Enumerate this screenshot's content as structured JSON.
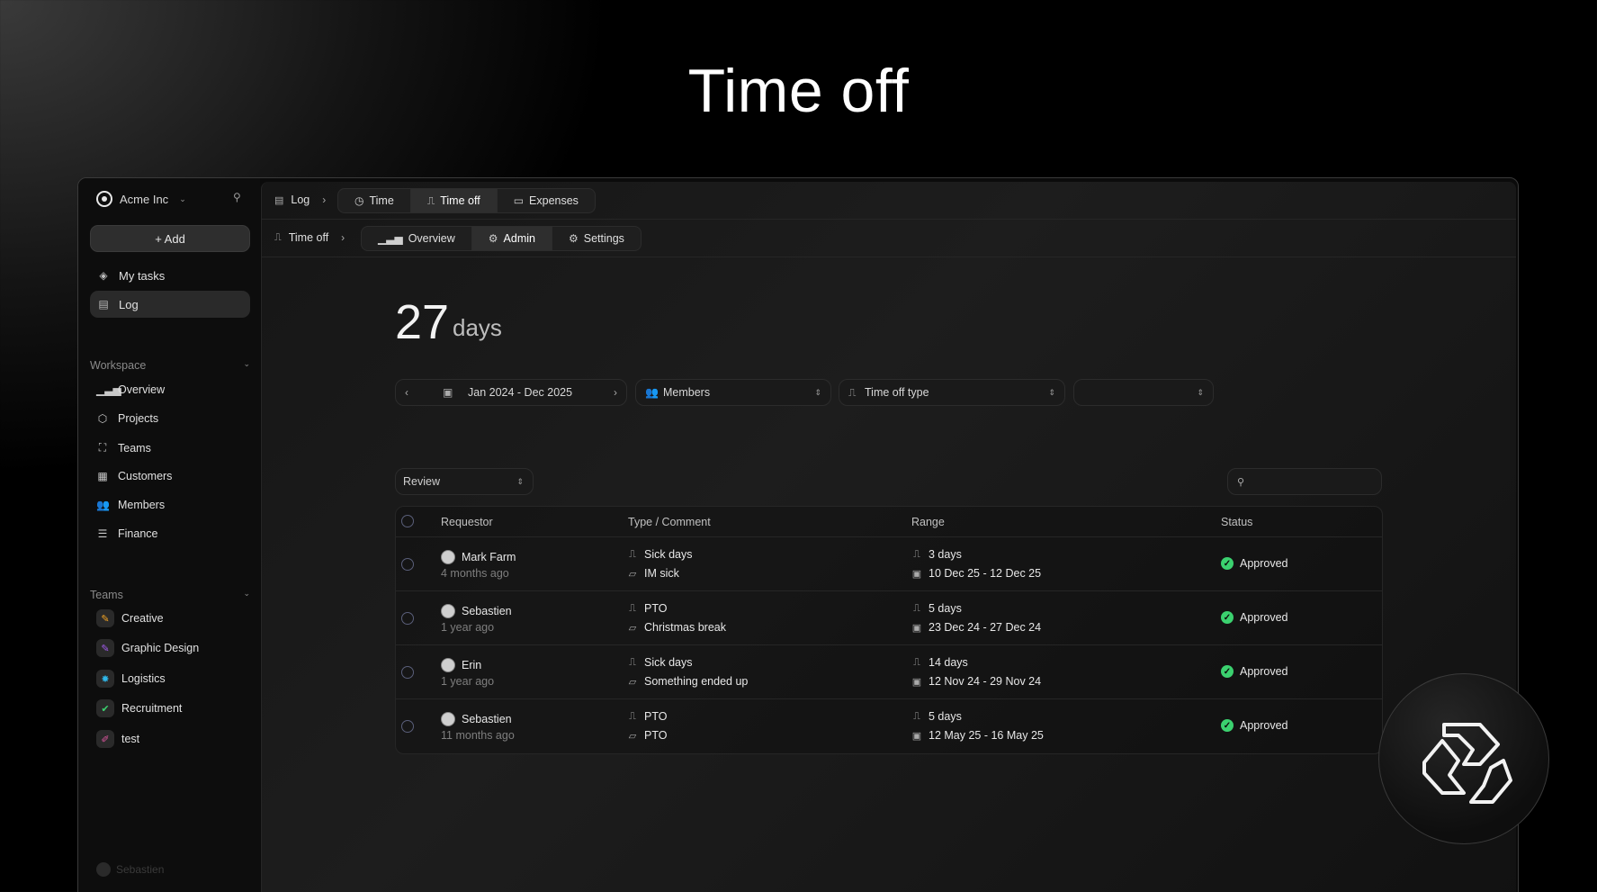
{
  "hero": {
    "title": "Time off"
  },
  "sidebar": {
    "org_name": "Acme Inc",
    "add_label": "+ Add",
    "top_items": [
      {
        "label": "My tasks",
        "icon": "stack-icon"
      },
      {
        "label": "Log",
        "icon": "doc-icon",
        "active": true
      }
    ],
    "workspace_label": "Workspace",
    "workspace_items": [
      {
        "label": "Overview",
        "icon": "bar-chart-icon"
      },
      {
        "label": "Projects",
        "icon": "box-icon"
      },
      {
        "label": "Teams",
        "icon": "scan-icon"
      },
      {
        "label": "Customers",
        "icon": "building-icon"
      },
      {
        "label": "Members",
        "icon": "users-icon"
      },
      {
        "label": "Finance",
        "icon": "database-icon"
      }
    ],
    "teams_label": "Teams",
    "teams": [
      {
        "label": "Creative",
        "color": "#f5a524"
      },
      {
        "label": "Graphic Design",
        "color": "#a45cf0"
      },
      {
        "label": "Logistics",
        "color": "#2fb6e8"
      },
      {
        "label": "Recruitment",
        "color": "#3bd16f"
      },
      {
        "label": "test",
        "color": "#e056a0"
      }
    ],
    "user_name": "Sebastien"
  },
  "topbar": {
    "crumb": "Log",
    "tabs": [
      {
        "label": "Time",
        "icon": "clock-icon"
      },
      {
        "label": "Time off",
        "icon": "door-icon",
        "active": true
      },
      {
        "label": "Expenses",
        "icon": "receipt-icon"
      }
    ]
  },
  "subbar": {
    "crumb": "Time off",
    "tabs": [
      {
        "label": "Overview",
        "icon": "bar-chart-icon"
      },
      {
        "label": "Admin",
        "icon": "admin-icon",
        "active": true
      },
      {
        "label": "Settings",
        "icon": "gear-icon"
      }
    ]
  },
  "summary": {
    "value": "27",
    "unit": "days"
  },
  "filters": {
    "date_range": "Jan 2024 - Dec 2025",
    "members_placeholder": "Members",
    "type_placeholder": "Time off type",
    "extra_value": ""
  },
  "review_select": "Review",
  "table": {
    "headers": {
      "requestor": "Requestor",
      "type": "Type / Comment",
      "range": "Range",
      "status": "Status"
    },
    "rows": [
      {
        "name": "Mark Farm",
        "ago": "4 months ago",
        "type": "Sick days",
        "comment": "IM sick",
        "days": "3 days",
        "dates": "10 Dec 25 - 12 Dec 25",
        "status": "Approved"
      },
      {
        "name": "Sebastien",
        "ago": "1 year ago",
        "type": "PTO",
        "comment": "Christmas break",
        "days": "5 days",
        "dates": "23 Dec 24 - 27 Dec 24",
        "status": "Approved"
      },
      {
        "name": "Erin",
        "ago": "1 year ago",
        "type": "Sick days",
        "comment": "Something ended up",
        "days": "14 days",
        "dates": "12 Nov 24 - 29 Nov 24",
        "status": "Approved"
      },
      {
        "name": "Sebastien",
        "ago": "11 months ago",
        "type": "PTO",
        "comment": "PTO",
        "days": "5 days",
        "dates": "12 May 25 - 16 May 25",
        "status": "Approved"
      }
    ]
  },
  "colors": {
    "approved": "#3bd16f",
    "accent": "#2e2e2e"
  }
}
